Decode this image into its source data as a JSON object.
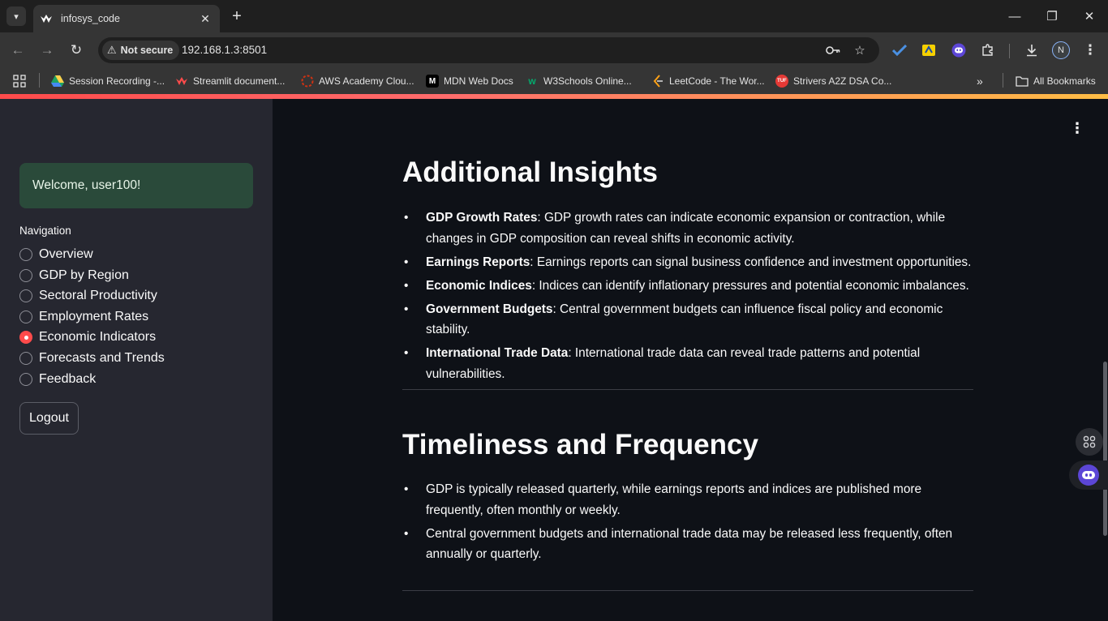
{
  "browser": {
    "tab": {
      "title": "infosys_code"
    },
    "omnibox": {
      "security_label": "Not secure",
      "url": "192.168.1.3:8501"
    },
    "profile_initial": "N",
    "bookmarks": [
      {
        "label": "Session Recording -...",
        "color": "#f4b400"
      },
      {
        "label": "Streamlit document...",
        "color": "#ff4b4b"
      },
      {
        "label": "AWS Academy Clou...",
        "color": "#d13212"
      },
      {
        "label": "MDN Web Docs",
        "color": "#ffffff"
      },
      {
        "label": "W3Schools Online...",
        "color": "#04aa6d"
      },
      {
        "label": "LeetCode - The Wor...",
        "color": "#ffa116"
      },
      {
        "label": "Strivers A2Z DSA Co...",
        "color": "#e53935"
      }
    ],
    "all_bookmarks": "All Bookmarks"
  },
  "sidebar": {
    "welcome": "Welcome, user100!",
    "nav_label": "Navigation",
    "options": [
      "Overview",
      "GDP by Region",
      "Sectoral Productivity",
      "Employment Rates",
      "Economic Indicators",
      "Forecasts and Trends",
      "Feedback"
    ],
    "selected": "Economic Indicators",
    "logout": "Logout"
  },
  "main": {
    "insights": {
      "title": "Additional Insights",
      "items": [
        {
          "term": "GDP Growth Rates",
          "text": ": GDP growth rates can indicate economic expansion or contraction, while changes in GDP composition can reveal shifts in economic activity."
        },
        {
          "term": "Earnings Reports",
          "text": ": Earnings reports can signal business confidence and investment opportunities."
        },
        {
          "term": "Economic Indices",
          "text": ": Indices can identify inflationary pressures and potential economic imbalances."
        },
        {
          "term": "Government Budgets",
          "text": ": Central government budgets can influence fiscal policy and economic stability."
        },
        {
          "term": "International Trade Data",
          "text": ": International trade data can reveal trade patterns and potential vulnerabilities."
        }
      ]
    },
    "timeliness": {
      "title": "Timeliness and Frequency",
      "items": [
        "GDP is typically released quarterly, while earnings reports and indices are published more frequently, often monthly or weekly.",
        "Central government budgets and international trade data may be released less frequently, often annually or quarterly."
      ]
    }
  },
  "colors": {
    "accent": "#ff4b4b",
    "welcome_bg": "#2a4a3a",
    "sidebar_bg": "#262730",
    "main_bg": "#0e1117"
  }
}
